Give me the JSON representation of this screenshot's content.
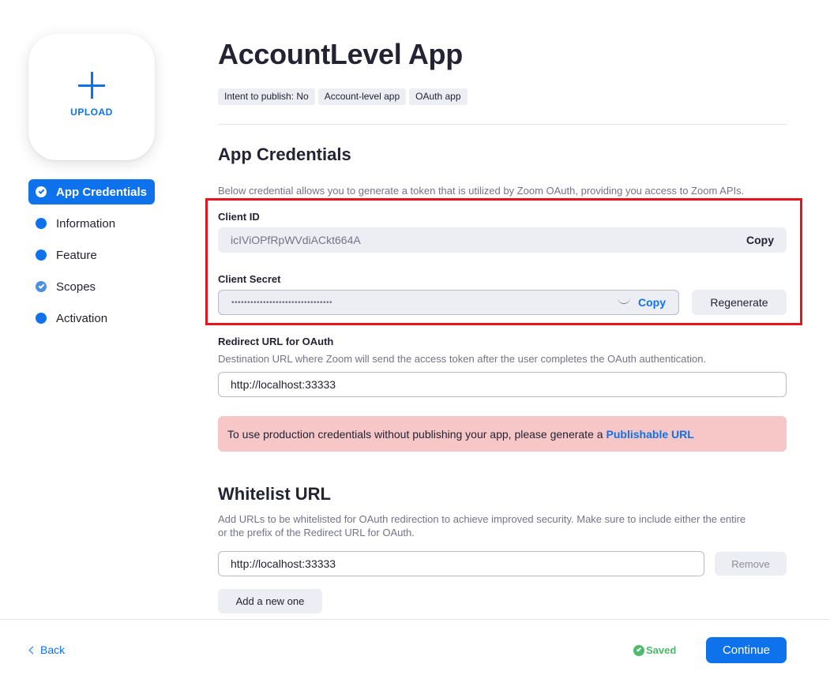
{
  "upload": {
    "label": "UPLOAD"
  },
  "sidebar": {
    "items": [
      {
        "label": "App Credentials",
        "active": true,
        "checked": true
      },
      {
        "label": "Information",
        "checked": false
      },
      {
        "label": "Feature",
        "checked": false
      },
      {
        "label": "Scopes",
        "checked": true
      },
      {
        "label": "Activation",
        "checked": false
      }
    ]
  },
  "header": {
    "title": "AccountLevel App",
    "tags": [
      "Intent to publish: No",
      "Account-level app",
      "OAuth app"
    ]
  },
  "credentials": {
    "title": "App Credentials",
    "description": "Below credential allows you to generate a token that is utilized by Zoom OAuth, providing you access to Zoom APIs.",
    "client_id_label": "Client ID",
    "client_id_value": "icIViOPfRpWVdiACkt664A",
    "client_id_copy": "Copy",
    "client_secret_label": "Client Secret",
    "client_secret_value": "••••••••••••••••••••••••••••••••",
    "client_secret_copy": "Copy",
    "regenerate_label": "Regenerate"
  },
  "redirect": {
    "label": "Redirect URL for OAuth",
    "description": "Destination URL where Zoom will send the access token after the user completes the OAuth authentication.",
    "value": "http://localhost:33333"
  },
  "alert": {
    "text": "To use production credentials without publishing your app, please generate a",
    "link": "Publishable URL"
  },
  "whitelist": {
    "title": "Whitelist URL",
    "description_line1": "Add URLs to be whitelisted for OAuth redirection to achieve improved security. Make sure to include either the entire",
    "description_line2": "or the prefix of the Redirect URL for OAuth.",
    "value": "http://localhost:33333",
    "remove_label": "Remove",
    "add_label": "Add a new one"
  },
  "footer": {
    "back_label": "Back",
    "saved_label": "Saved",
    "continue_label": "Continue"
  },
  "colors": {
    "accent": "#0e72ed",
    "alert_bg": "#f7c7c8",
    "highlight": "#e8161c",
    "saved": "#4dbb6b"
  }
}
